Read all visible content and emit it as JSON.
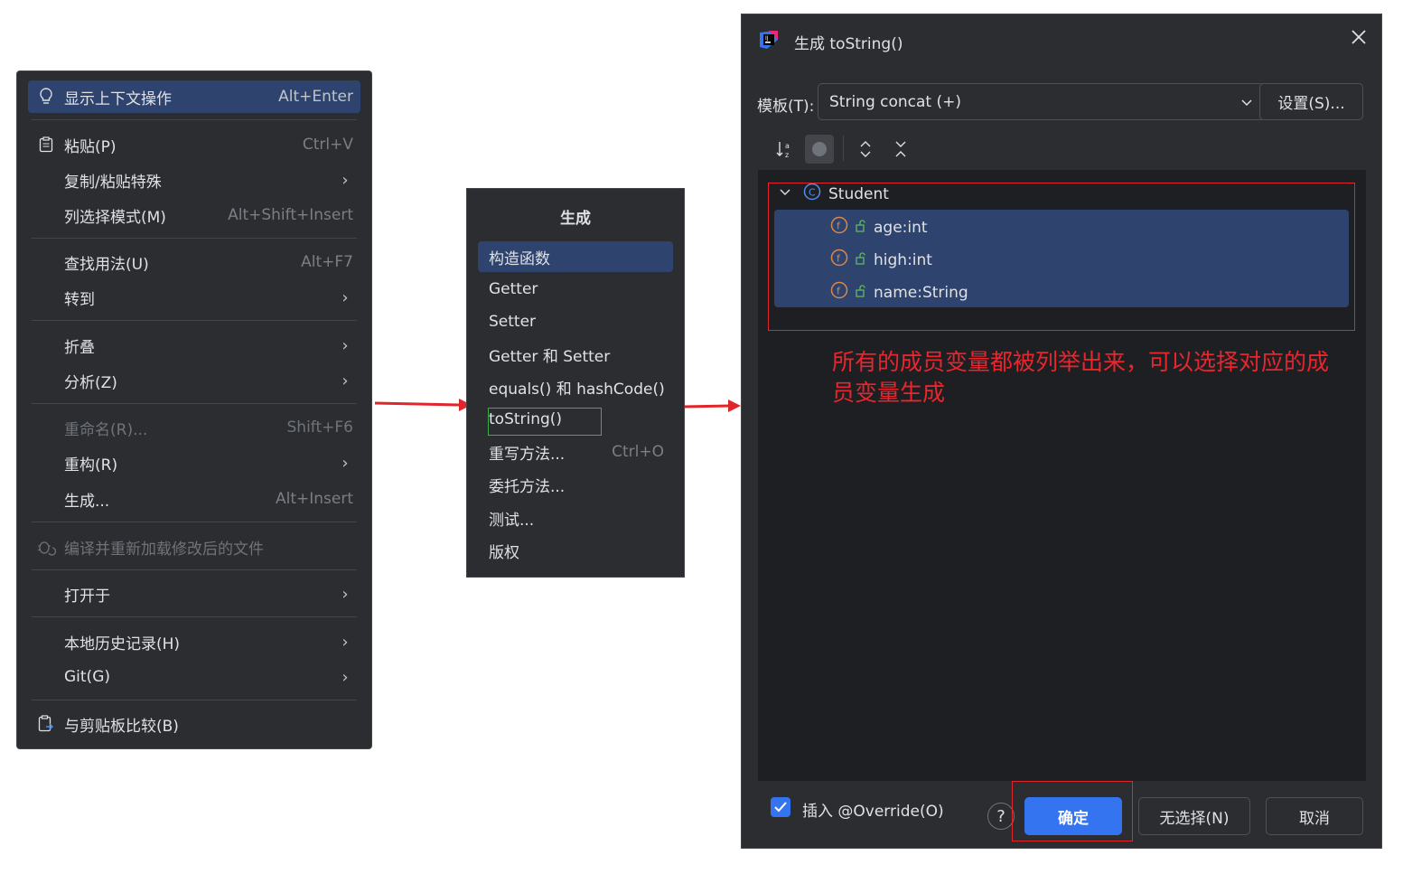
{
  "context_menu": {
    "items": [
      {
        "label": "显示上下文操作",
        "shortcut": "Alt+Enter"
      },
      {
        "label": "粘贴(P)",
        "shortcut": "Ctrl+V"
      },
      {
        "label": "复制/粘贴特殊"
      },
      {
        "label": "列选择模式(M)",
        "shortcut": "Alt+Shift+Insert"
      },
      {
        "label": "查找用法(U)",
        "shortcut": "Alt+F7"
      },
      {
        "label": "转到"
      },
      {
        "label": "折叠"
      },
      {
        "label": "分析(Z)"
      },
      {
        "label": "重命名(R)...",
        "shortcut": "Shift+F6"
      },
      {
        "label": "重构(R)"
      },
      {
        "label": "生成...",
        "shortcut": "Alt+Insert"
      },
      {
        "label": "编译并重新加载修改后的文件"
      },
      {
        "label": "打开于"
      },
      {
        "label": "本地历史记录(H)"
      },
      {
        "label": "Git(G)"
      },
      {
        "label": "与剪贴板比较(B)"
      }
    ]
  },
  "generate_menu": {
    "title": "生成",
    "items": [
      {
        "label": "构造函数"
      },
      {
        "label": "Getter"
      },
      {
        "label": "Setter"
      },
      {
        "label": "Getter 和 Setter"
      },
      {
        "label": "equals() 和 hashCode()"
      },
      {
        "label": "toString()"
      },
      {
        "label": "重写方法...",
        "shortcut": "Ctrl+O"
      },
      {
        "label": "委托方法..."
      },
      {
        "label": "测试..."
      },
      {
        "label": "版权"
      }
    ]
  },
  "dialog": {
    "title": "生成 toString()",
    "template_label": "模板(T):",
    "template_value": "String concat (+)",
    "settings_button": "设置(S)...",
    "tree": {
      "class_name": "Student",
      "fields": [
        "age:int",
        "high:int",
        "name:String"
      ]
    },
    "note": "所有的成员变量都被列举出来，可以选择对应的成员变量生成",
    "override_checkbox": "插入 @Override(O)",
    "override_checked": true,
    "help": "?",
    "ok_button": "确定",
    "none_button": "无选择(N)",
    "cancel_button": "取消"
  },
  "colors": {
    "menu_bg": "#2b2d30",
    "selection": "#2e436e",
    "accent": "#3574f0",
    "annotation_red": "#e0262b",
    "annotation_green": "#3fae4a"
  }
}
